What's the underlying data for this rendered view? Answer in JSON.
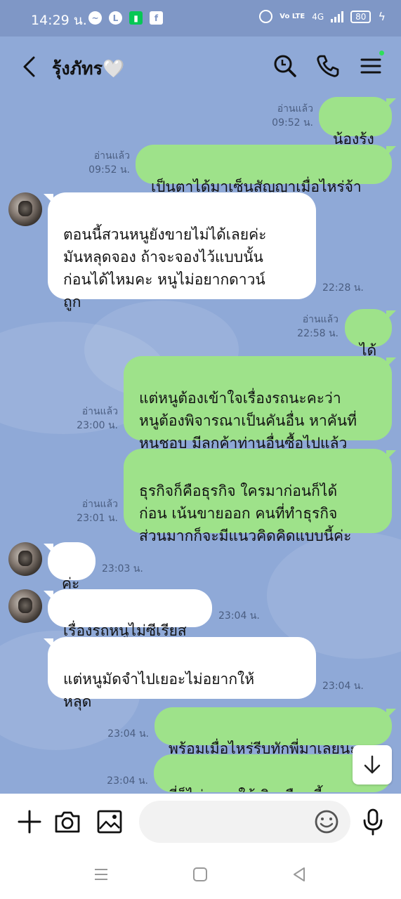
{
  "status": {
    "time": "14:29 น.",
    "left_icons": [
      "messenger-icon",
      "line-icon",
      "battery-saver-icon",
      "facebook-icon"
    ],
    "battery": "80",
    "network": "4G",
    "volte": "Vo LTE"
  },
  "header": {
    "title": "รุ้งภัทร🤍",
    "icons": [
      "back-icon",
      "search-icon",
      "phone-icon",
      "menu-icon"
    ]
  },
  "messages": [
    {
      "dir": "out",
      "text": "น้องรุ้ง",
      "read": "อ่านแล้ว",
      "time": "09:52 น."
    },
    {
      "dir": "out",
      "text": "เป็นตาได้มาเซ็นสัญญาเมื่อไหร่จ้า",
      "read": "อ่านแล้ว",
      "time": "09:52 น."
    },
    {
      "dir": "in",
      "text": "ตอนนี้สวนหนูยังขายไม่ได้เลยค่ะ\nมันหลุดจอง ถ้าจะจองไว้แบบนั้น\nก่อนได้ไหมคะ หนูไม่อยากดาวน์\nถูก",
      "time": "22:28 น."
    },
    {
      "dir": "out",
      "text": "ได้",
      "read": "อ่านแล้ว",
      "time": "22:58 น."
    },
    {
      "dir": "out",
      "text": "แต่หนูต้องเข้าใจเรื่องรถนะคะว่า\nหนูต้องพิจารณาเป็นคันอื่น หาคันที่\nหนูชอบ มีลูกค้าท่านอื่นซื้อไปแล้ว",
      "read": "อ่านแล้ว",
      "time": "23:00 น."
    },
    {
      "dir": "out",
      "text": "ธุรกิจก็คือธุรกิจ ใครมาก่อนก็ได้\nก่อน เน้นขายออก คนที่ทำธุรกิจ\nส่วนมากก็จะมีแนวคิดคิดแบบนี้ค่ะ",
      "read": "อ่านแล้ว",
      "time": "23:01 น."
    },
    {
      "dir": "in",
      "text": "ค่ะ",
      "time": "23:03 น."
    },
    {
      "dir": "in",
      "text": "เรื่องรถหนูไม่ซีเรียส",
      "time": "23:04 น."
    },
    {
      "dir": "in",
      "text": "แต่หนูมัดจำไปเยอะไม่อยากให้\nหลุด",
      "time": "23:04 น."
    },
    {
      "dir": "out",
      "text": "พร้อมเมื่อไหร่รีบทักพี่มาเลยนะ",
      "time": "23:04 น."
    },
    {
      "dir": "out",
      "text": "พี่ก็ไม่อยากให้เกินเดือนนี้แห",
      "time": "23:04 น."
    }
  ],
  "input": {
    "placeholder": "",
    "icons": [
      "plus-icon",
      "camera-icon",
      "image-icon",
      "emoji-icon",
      "microphone-icon"
    ]
  },
  "nav": {
    "icons": [
      "recent-apps-icon",
      "home-icon",
      "back-nav-icon"
    ]
  },
  "colors": {
    "background": "#8fa9d7",
    "outgoing": "#9ee28a",
    "incoming": "#ffffff",
    "online_dot": "#2ee05a"
  }
}
